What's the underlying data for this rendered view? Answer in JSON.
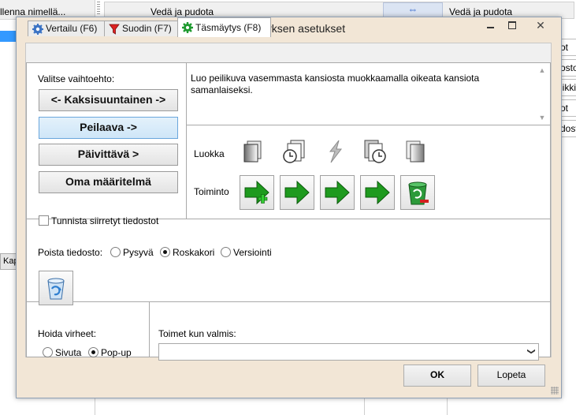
{
  "background": {
    "save_label": "llenna nimellä...",
    "left_header": "Vedä ja pudota",
    "right_header": "Vedä ja pudota",
    "swap_symbol": "⇔",
    "right_cells": [
      "ot",
      "osto",
      "iikki",
      "ot",
      "dost"
    ],
    "kap_button": "Kap"
  },
  "dialog": {
    "title": "Täsmäyksen asetukset",
    "close_symbol": "✕",
    "tabs": [
      {
        "label": "Vertailu (F6)",
        "icon": "gear-icon"
      },
      {
        "label": "Suodin (F7)",
        "icon": "filter-icon"
      },
      {
        "label": "Täsmäytys (F8)",
        "icon": "gear-green-icon",
        "active": true
      }
    ],
    "choose_label": "Valitse vaihtoehto:",
    "variants": [
      {
        "label": "<- Kaksisuuntainen ->",
        "selected": false
      },
      {
        "label": "Peilaava ->",
        "selected": true
      },
      {
        "label": "Päivittävä >",
        "selected": false
      },
      {
        "label": "Oma määritelmä",
        "selected": false
      }
    ],
    "detect_moved_label": "Tunnista siirretyt tiedostot",
    "detect_moved_checked": false,
    "description": "Luo peilikuva vasemmasta kansiosta muokkaamalla oikeata kansiota samanlaiseksi.",
    "category_label": "Luokka",
    "category_icons": [
      "file-only-left-icon",
      "left-newer-icon",
      "conflict-icon",
      "right-newer-icon",
      "file-only-right-icon"
    ],
    "action_label": "Toiminto",
    "actions": [
      "create-right-icon",
      "overwrite-right-icon",
      "overwrite-right-icon",
      "overwrite-right-icon",
      "delete-right-icon"
    ],
    "delete_label": "Poista tiedosto:",
    "delete_options": [
      {
        "label": "Pysyvä",
        "checked": false
      },
      {
        "label": "Roskakori",
        "checked": true
      },
      {
        "label": "Versiointi",
        "checked": false
      }
    ],
    "errors_label": "Hoida virheet:",
    "error_options": [
      {
        "label": "Sivuta",
        "checked": false
      },
      {
        "label": "Pop-up",
        "checked": true
      }
    ],
    "on_completion_label": "Toimet kun valmis:",
    "on_completion_value": "",
    "ok_label": "OK",
    "cancel_label": "Lopeta",
    "accent_color": "#3399ff",
    "arrow_color": "#1e8a1e"
  }
}
